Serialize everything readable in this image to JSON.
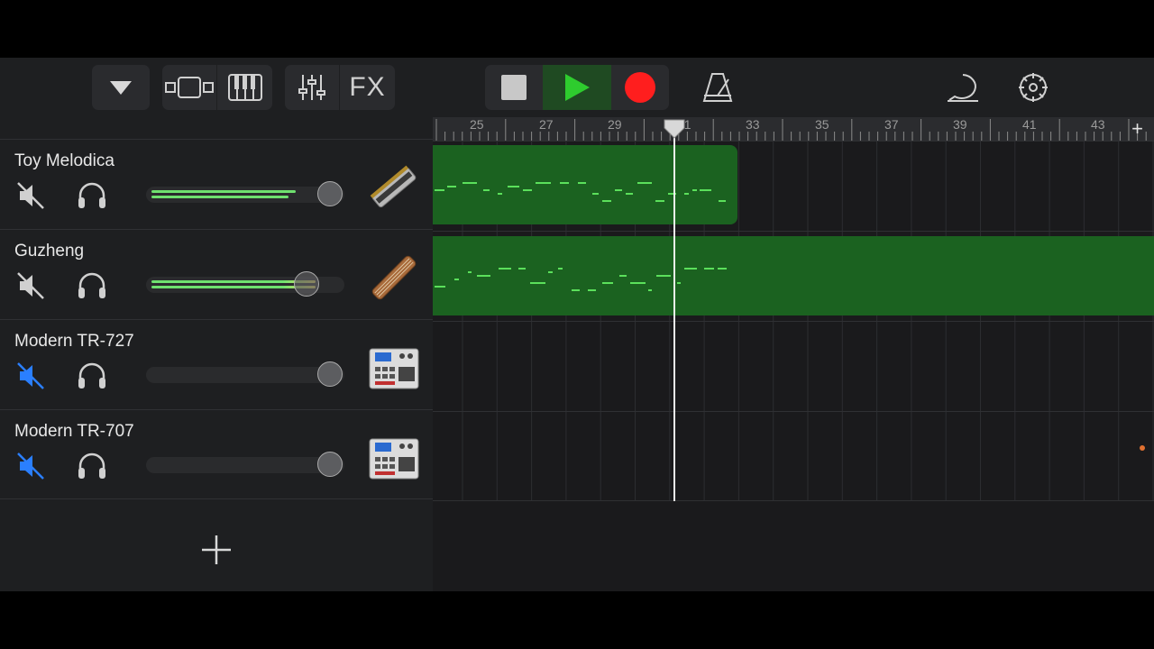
{
  "toolbar": {
    "tracks_menu_icon": "triangle-down-icon",
    "view_icon": "tracks-view-icon",
    "keyboard_icon": "piano-keys-icon",
    "mixer_icon": "mixer-sliders-icon",
    "fx_label": "FX",
    "stop_icon": "stop-icon",
    "play_icon": "play-icon",
    "record_icon": "record-icon",
    "metronome_icon": "metronome-icon",
    "loop_icon": "loop-browser-icon",
    "settings_icon": "gear-icon"
  },
  "colors": {
    "play": "#2ecc2e",
    "record": "#ff1e1e",
    "region": "#1b6220",
    "muted_icon": "#2a7fff",
    "level": "#6fe06f"
  },
  "ruler": {
    "bars": [
      "25",
      "27",
      "29",
      "31",
      "33",
      "35",
      "37",
      "39",
      "41",
      "43"
    ],
    "add_label": "+"
  },
  "tracks": [
    {
      "name": "Toy Melodica",
      "instrument_icon": "harmonica-icon",
      "muted": false,
      "volume": 0.93
    },
    {
      "name": "Guzheng",
      "instrument_icon": "guzheng-icon",
      "muted": false,
      "volume": 0.81
    },
    {
      "name": "Modern TR-727",
      "instrument_icon": "drum-machine-icon",
      "muted": true,
      "volume": 0.93
    },
    {
      "name": "Modern TR-707",
      "instrument_icon": "drum-machine-icon",
      "muted": true,
      "volume": 0.93
    }
  ],
  "add_track_icon": "plus-icon"
}
